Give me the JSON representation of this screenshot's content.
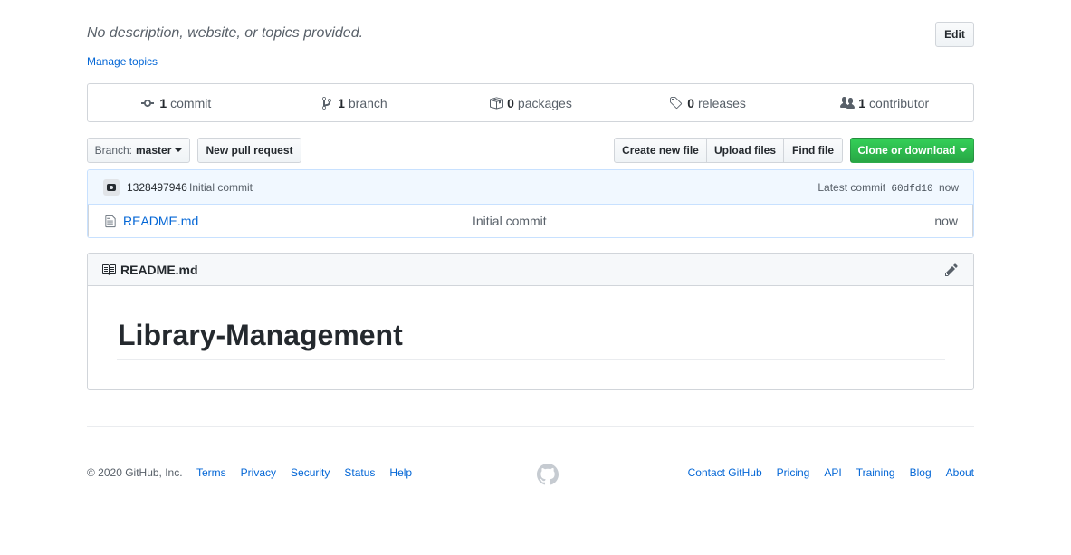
{
  "repo": {
    "description": "No description, website, or topics provided.",
    "edit_label": "Edit",
    "manage_topics": "Manage topics"
  },
  "summary": [
    {
      "icon": "commit-icon",
      "count": "1",
      "label": "commit"
    },
    {
      "icon": "branch-icon",
      "count": "1",
      "label": "branch"
    },
    {
      "icon": "package-icon",
      "count": "0",
      "label": "packages"
    },
    {
      "icon": "tag-icon",
      "count": "0",
      "label": "releases"
    },
    {
      "icon": "people-icon",
      "count": "1",
      "label": "contributor"
    }
  ],
  "toolbar": {
    "branch_prefix": "Branch:",
    "branch_name": "master",
    "new_pr": "New pull request",
    "create_file": "Create new file",
    "upload_files": "Upload files",
    "find_file": "Find file",
    "clone": "Clone or download"
  },
  "latest_commit": {
    "author": "1328497946",
    "message": "Initial commit",
    "label": "Latest commit",
    "sha": "60dfd10",
    "age": "now"
  },
  "files": [
    {
      "name": "README.md",
      "commit": "Initial commit",
      "age": "now"
    }
  ],
  "readme": {
    "filename": "README.md",
    "heading": "Library-Management"
  },
  "footer": {
    "copyright": "© 2020 GitHub, Inc.",
    "left_links": [
      "Terms",
      "Privacy",
      "Security",
      "Status",
      "Help"
    ],
    "right_links": [
      "Contact GitHub",
      "Pricing",
      "API",
      "Training",
      "Blog",
      "About"
    ]
  },
  "colors": {
    "link": "#0366d6",
    "clone_green": "#28a745",
    "commit_bg": "#f1f8ff"
  }
}
